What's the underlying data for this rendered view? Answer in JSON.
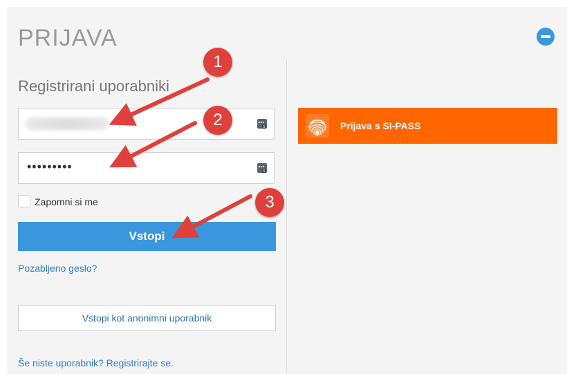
{
  "title": "PRIJAVA",
  "subtitle": "Registrirani uporabniki",
  "username": {
    "value": ""
  },
  "password": {
    "masked": "•••••••••"
  },
  "remember_label": "Zapomni si me",
  "login_label": "Vstopi",
  "forgot_label": "Pozabljeno geslo?",
  "anonymous_label": "Vstopi kot anonimni uporabnik",
  "register_label": "Še niste uporabnik? Registrirajte se.",
  "sipass_label": "Prijava s SI-PASS",
  "badges": [
    "1",
    "2",
    "3"
  ],
  "colors": {
    "primary": "#3a96dd",
    "sipass": "#ff6600",
    "annotation": "#e0403c"
  },
  "icons": {
    "collapse": "minus-circle-icon",
    "field": "key-badge-icon",
    "sipass": "fingerprint-icon"
  }
}
